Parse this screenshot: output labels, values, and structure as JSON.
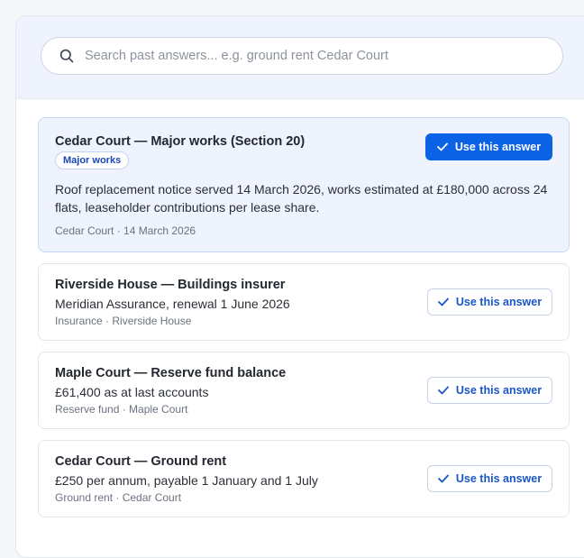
{
  "search": {
    "placeholder": "Search past answers... e.g. ground rent Cedar Court",
    "value": ""
  },
  "results": [
    {
      "title": "Cedar Court — Major works (Section 20)",
      "badge": "Major works",
      "value": "Roof replacement notice served 14 March 2026, works estimated at £180,000 across 24 flats, leaseholder contributions per lease share.",
      "meta": "Cedar Court · 14 March 2026",
      "action": "Use this answer"
    },
    {
      "title": "Riverside House — Buildings insurer",
      "value": "Meridian Assurance, renewal 1 June 2026",
      "meta": "Insurance · Riverside House",
      "action": "Use this answer"
    },
    {
      "title": "Maple Court — Reserve fund balance",
      "value": "£61,400 as at last accounts",
      "meta": "Reserve fund · Maple Court",
      "action": "Use this answer"
    },
    {
      "title": "Cedar Court — Ground rent",
      "value": "£250 per annum, payable 1 January and 1 July",
      "meta": "Ground rent · Cedar Court",
      "action": "Use this answer"
    }
  ],
  "colors": {
    "primary": "#0b62e4",
    "featured_bg": "#eef3fd",
    "badge_text": "#1747b8"
  },
  "icons": {
    "search": "search-icon",
    "action": "check-icon"
  }
}
